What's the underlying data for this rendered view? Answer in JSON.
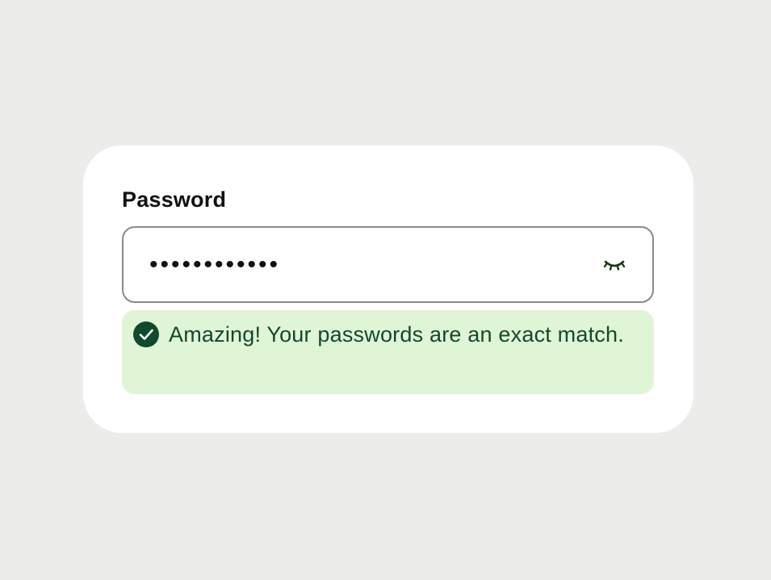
{
  "field": {
    "label": "Password",
    "masked_value": "••••••••••••",
    "toggle_icon": "eye-closed-icon"
  },
  "validation": {
    "status": "success",
    "icon": "check-circle-icon",
    "message": "Amazing! Your passwords are an exact match."
  },
  "colors": {
    "background": "#ecedea",
    "card": "#ffffff",
    "success_bg": "#e0f4d6",
    "success_text": "#114a2a",
    "success_icon": "#0e4a2b",
    "input_border": "#8a8a8a"
  }
}
